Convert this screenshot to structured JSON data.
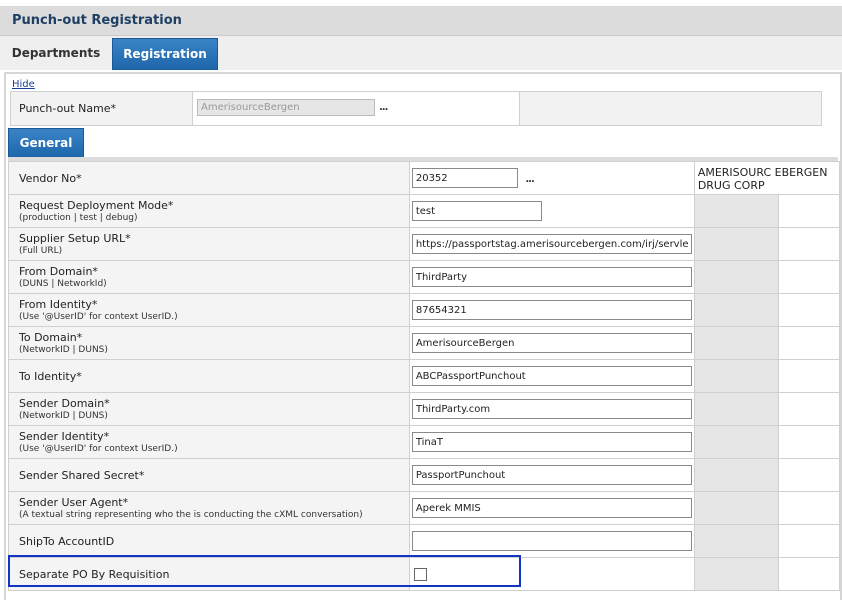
{
  "page": {
    "title": "Punch-out Registration"
  },
  "tabs": [
    {
      "label": "Departments"
    },
    {
      "label": "Registration",
      "active": true
    }
  ],
  "panel": {
    "hide_link": "Hide",
    "punchout_name_label": "Punch-out Name*",
    "punchout_name_value": "AmerisourceBergen",
    "lookup_glyph": "...",
    "subtab": "General"
  },
  "vendor_name": "AMERISOURC EBERGEN DRUG CORP",
  "fields": [
    {
      "label": "Vendor No*",
      "hint": "",
      "value": "20352",
      "lookup": true
    },
    {
      "label": "Request Deployment Mode*",
      "hint": "(production | test | debug)",
      "value": "test"
    },
    {
      "label": "Supplier Setup URL*",
      "hint": "(Full URL)",
      "value": "https://passportstag.amerisourcebergen.com/irj/servlet/prt"
    },
    {
      "label": "From Domain*",
      "hint": "(DUNS | NetworkId)",
      "value": "ThirdParty"
    },
    {
      "label": "From Identity*",
      "hint": "(Use '@UserID' for context UserID.)",
      "value": "87654321"
    },
    {
      "label": "To Domain*",
      "hint": "(NetworkID | DUNS)",
      "value": "AmerisourceBergen"
    },
    {
      "label": "To Identity*",
      "hint": "",
      "value": "ABCPassportPunchout"
    },
    {
      "label": "Sender Domain*",
      "hint": "(NetworkID | DUNS)",
      "value": "ThirdParty.com"
    },
    {
      "label": "Sender Identity*",
      "hint": "(Use '@UserID' for context UserID.)",
      "value": "TinaT"
    },
    {
      "label": "Sender Shared Secret*",
      "hint": "",
      "value": "PassportPunchout"
    },
    {
      "label": "Sender User Agent*",
      "hint": "(A textual string representing who the is conducting the cXML conversation)",
      "value": "Aperek MMIS"
    },
    {
      "label": "ShipTo AccountID",
      "hint": "",
      "value": ""
    }
  ],
  "separate_po": {
    "label": "Separate PO By Requisition",
    "checked": false
  },
  "colors": {
    "accent": "#1f66ab",
    "title_text": "#1f3f63",
    "highlight_border": "#1434c8"
  }
}
